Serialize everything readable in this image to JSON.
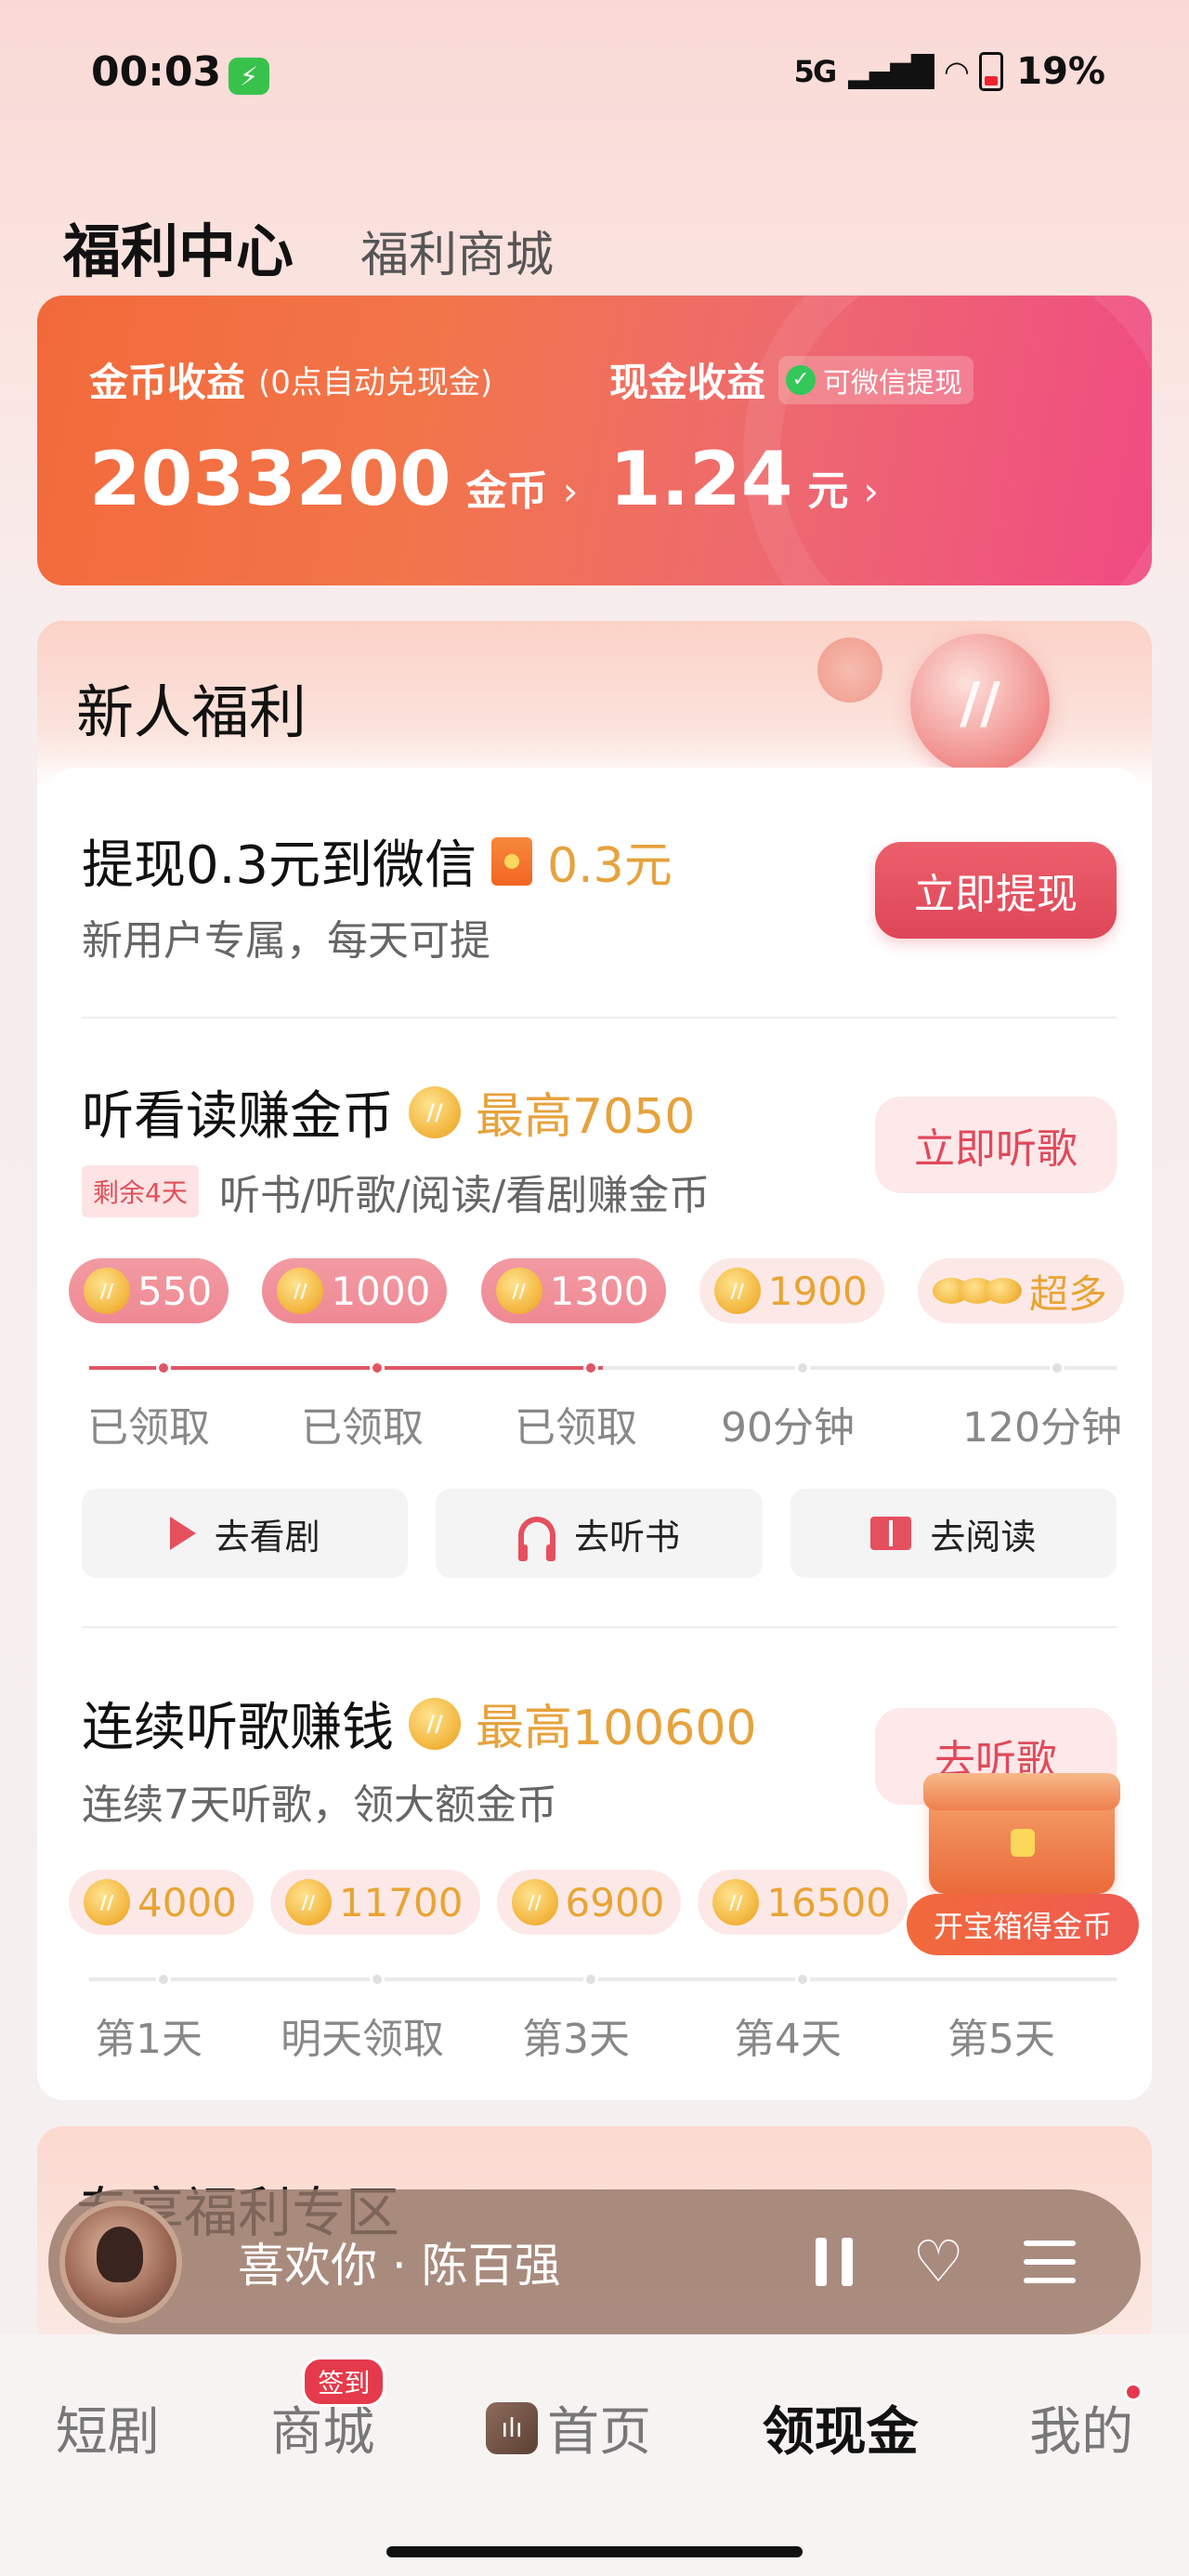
{
  "status_bar": {
    "time": "00:03",
    "network": "5G",
    "battery": "19%"
  },
  "top_tabs": {
    "active": "福利中心",
    "inactive": "福利商城"
  },
  "earnings": {
    "coin_label": "金币收益",
    "coin_note": "(0点自动兑现金)",
    "coin_value": "2033200",
    "coin_unit": "金币",
    "cash_label": "现金收益",
    "cash_badge": "可微信提现",
    "cash_value": "1.24",
    "cash_unit": "元",
    "chevron": "›"
  },
  "newbie": {
    "title": "新人福利",
    "withdraw": {
      "title": "提现0.3元到微信",
      "amount": "0.3元",
      "subtitle": "新用户专属，每天可提",
      "button": "立即提现"
    },
    "listen_earn": {
      "title": "听看读赚金币",
      "max": "最高7050",
      "remain_tag": "剩余4天",
      "subtitle": "听书/听歌/阅读/看剧赚金币",
      "button": "立即听歌",
      "progress_fraction": 0.5,
      "rewards": [
        {
          "amount": "550",
          "claimed": true
        },
        {
          "amount": "1000",
          "claimed": true
        },
        {
          "amount": "1300",
          "claimed": true
        },
        {
          "amount": "1900",
          "claimed": false
        },
        {
          "amount": "超多",
          "claimed": false
        }
      ],
      "labels": [
        "已领取",
        "已领取",
        "已领取",
        "90分钟",
        "120分钟"
      ],
      "actions": [
        "去看剧",
        "去听书",
        "去阅读"
      ]
    },
    "streak": {
      "title": "连续听歌赚钱",
      "max": "最高100600",
      "subtitle": "连续7天听歌，领大额金币",
      "button": "去听歌",
      "rewards": [
        "4000",
        "11700",
        "6900",
        "16500"
      ],
      "labels": [
        "第1天",
        "明天领取",
        "第3天",
        "第4天",
        "第5天"
      ],
      "chest_label": "开宝箱得金币"
    }
  },
  "next_section": {
    "title_partial": "专享福利专区"
  },
  "player": {
    "song": "喜欢你 · 陈百强"
  },
  "bottom_nav": {
    "items": [
      "短剧",
      "商城",
      "首页",
      "领现金",
      "我的"
    ],
    "mall_badge": "签到",
    "active": "领现金"
  },
  "colors": {
    "accent": "#e04a5b",
    "gold": "#e6a23c",
    "banner_start": "#f26a3b",
    "banner_end": "#f04b83"
  }
}
